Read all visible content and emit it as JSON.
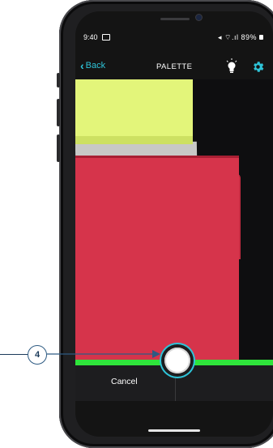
{
  "status_bar": {
    "time": "9:40",
    "icons_text": "◀ ≋.ıl 89%",
    "battery": "89%"
  },
  "nav": {
    "back_label": "Back",
    "title": "PALETTE"
  },
  "controls": {
    "cancel_label": "Cancel"
  },
  "callout": {
    "number": "4"
  },
  "colors": {
    "accent": "#2ec4d8",
    "scan_line": "#2fe43b",
    "yellow_folder": "#e3f57a",
    "red_folder": "#d6344b",
    "callout": "#2d5a82"
  },
  "icons": [
    "image-icon",
    "mute-icon",
    "wifi-icon",
    "signal-icon",
    "battery-icon",
    "back-chevron-icon",
    "lightbulb-icon",
    "gear-icon",
    "shutter-icon"
  ]
}
